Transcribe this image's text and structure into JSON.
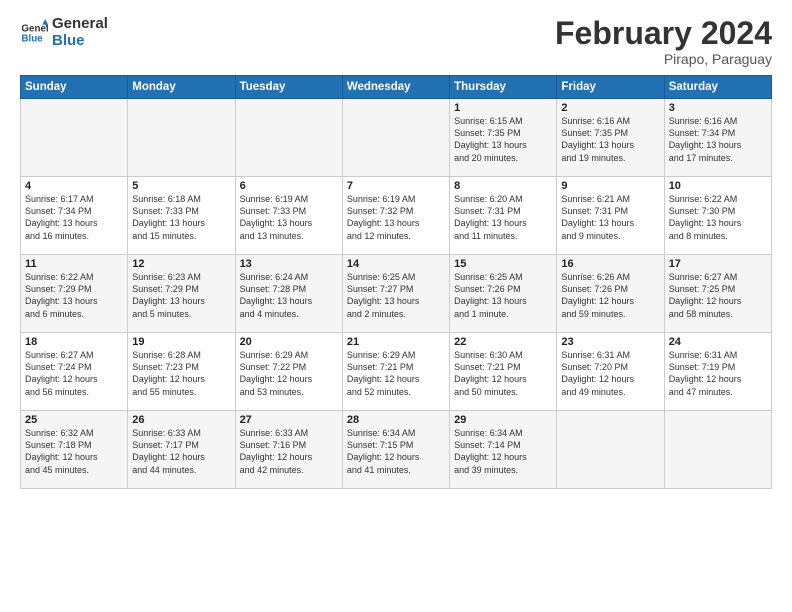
{
  "logo": {
    "line1": "General",
    "line2": "Blue"
  },
  "title": "February 2024",
  "subtitle": "Pirapo, Paraguay",
  "days_of_week": [
    "Sunday",
    "Monday",
    "Tuesday",
    "Wednesday",
    "Thursday",
    "Friday",
    "Saturday"
  ],
  "weeks": [
    [
      {
        "day": "",
        "info": ""
      },
      {
        "day": "",
        "info": ""
      },
      {
        "day": "",
        "info": ""
      },
      {
        "day": "",
        "info": ""
      },
      {
        "day": "1",
        "info": "Sunrise: 6:15 AM\nSunset: 7:35 PM\nDaylight: 13 hours\nand 20 minutes."
      },
      {
        "day": "2",
        "info": "Sunrise: 6:16 AM\nSunset: 7:35 PM\nDaylight: 13 hours\nand 19 minutes."
      },
      {
        "day": "3",
        "info": "Sunrise: 6:16 AM\nSunset: 7:34 PM\nDaylight: 13 hours\nand 17 minutes."
      }
    ],
    [
      {
        "day": "4",
        "info": "Sunrise: 6:17 AM\nSunset: 7:34 PM\nDaylight: 13 hours\nand 16 minutes."
      },
      {
        "day": "5",
        "info": "Sunrise: 6:18 AM\nSunset: 7:33 PM\nDaylight: 13 hours\nand 15 minutes."
      },
      {
        "day": "6",
        "info": "Sunrise: 6:19 AM\nSunset: 7:33 PM\nDaylight: 13 hours\nand 13 minutes."
      },
      {
        "day": "7",
        "info": "Sunrise: 6:19 AM\nSunset: 7:32 PM\nDaylight: 13 hours\nand 12 minutes."
      },
      {
        "day": "8",
        "info": "Sunrise: 6:20 AM\nSunset: 7:31 PM\nDaylight: 13 hours\nand 11 minutes."
      },
      {
        "day": "9",
        "info": "Sunrise: 6:21 AM\nSunset: 7:31 PM\nDaylight: 13 hours\nand 9 minutes."
      },
      {
        "day": "10",
        "info": "Sunrise: 6:22 AM\nSunset: 7:30 PM\nDaylight: 13 hours\nand 8 minutes."
      }
    ],
    [
      {
        "day": "11",
        "info": "Sunrise: 6:22 AM\nSunset: 7:29 PM\nDaylight: 13 hours\nand 6 minutes."
      },
      {
        "day": "12",
        "info": "Sunrise: 6:23 AM\nSunset: 7:29 PM\nDaylight: 13 hours\nand 5 minutes."
      },
      {
        "day": "13",
        "info": "Sunrise: 6:24 AM\nSunset: 7:28 PM\nDaylight: 13 hours\nand 4 minutes."
      },
      {
        "day": "14",
        "info": "Sunrise: 6:25 AM\nSunset: 7:27 PM\nDaylight: 13 hours\nand 2 minutes."
      },
      {
        "day": "15",
        "info": "Sunrise: 6:25 AM\nSunset: 7:26 PM\nDaylight: 13 hours\nand 1 minute."
      },
      {
        "day": "16",
        "info": "Sunrise: 6:26 AM\nSunset: 7:26 PM\nDaylight: 12 hours\nand 59 minutes."
      },
      {
        "day": "17",
        "info": "Sunrise: 6:27 AM\nSunset: 7:25 PM\nDaylight: 12 hours\nand 58 minutes."
      }
    ],
    [
      {
        "day": "18",
        "info": "Sunrise: 6:27 AM\nSunset: 7:24 PM\nDaylight: 12 hours\nand 56 minutes."
      },
      {
        "day": "19",
        "info": "Sunrise: 6:28 AM\nSunset: 7:23 PM\nDaylight: 12 hours\nand 55 minutes."
      },
      {
        "day": "20",
        "info": "Sunrise: 6:29 AM\nSunset: 7:22 PM\nDaylight: 12 hours\nand 53 minutes."
      },
      {
        "day": "21",
        "info": "Sunrise: 6:29 AM\nSunset: 7:21 PM\nDaylight: 12 hours\nand 52 minutes."
      },
      {
        "day": "22",
        "info": "Sunrise: 6:30 AM\nSunset: 7:21 PM\nDaylight: 12 hours\nand 50 minutes."
      },
      {
        "day": "23",
        "info": "Sunrise: 6:31 AM\nSunset: 7:20 PM\nDaylight: 12 hours\nand 49 minutes."
      },
      {
        "day": "24",
        "info": "Sunrise: 6:31 AM\nSunset: 7:19 PM\nDaylight: 12 hours\nand 47 minutes."
      }
    ],
    [
      {
        "day": "25",
        "info": "Sunrise: 6:32 AM\nSunset: 7:18 PM\nDaylight: 12 hours\nand 45 minutes."
      },
      {
        "day": "26",
        "info": "Sunrise: 6:33 AM\nSunset: 7:17 PM\nDaylight: 12 hours\nand 44 minutes."
      },
      {
        "day": "27",
        "info": "Sunrise: 6:33 AM\nSunset: 7:16 PM\nDaylight: 12 hours\nand 42 minutes."
      },
      {
        "day": "28",
        "info": "Sunrise: 6:34 AM\nSunset: 7:15 PM\nDaylight: 12 hours\nand 41 minutes."
      },
      {
        "day": "29",
        "info": "Sunrise: 6:34 AM\nSunset: 7:14 PM\nDaylight: 12 hours\nand 39 minutes."
      },
      {
        "day": "",
        "info": ""
      },
      {
        "day": "",
        "info": ""
      }
    ]
  ]
}
